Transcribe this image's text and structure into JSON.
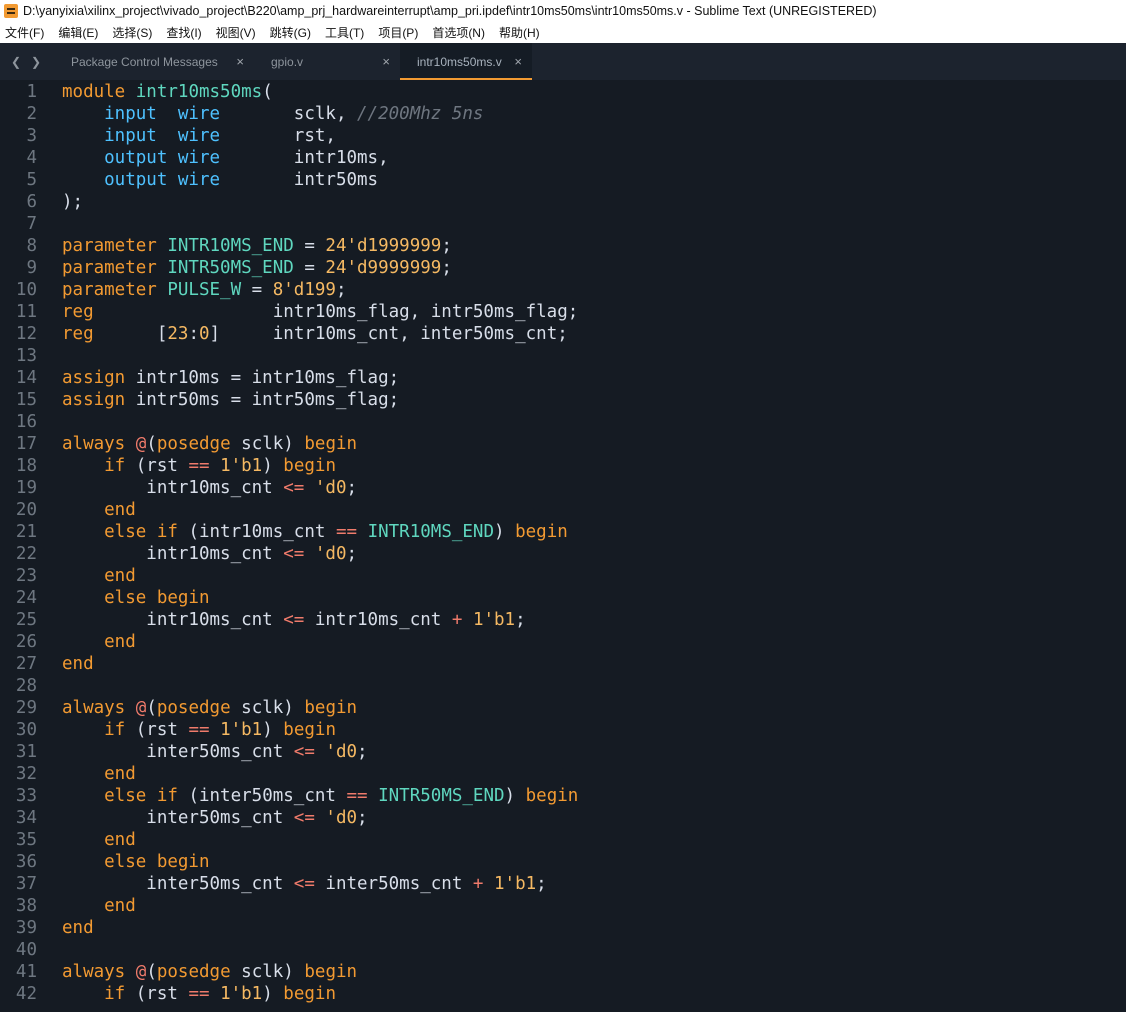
{
  "window": {
    "title": "D:\\yanyixia\\xilinx_project\\vivado_project\\B220\\amp_prj_hardwareinterrupt\\amp_pri.ipdef\\intr10ms50ms\\intr10ms50ms.v - Sublime Text (UNREGISTERED)",
    "app_icon": "sublime-text-icon"
  },
  "menu": [
    "文件(F)",
    "编辑(E)",
    "选择(S)",
    "查找(I)",
    "视图(V)",
    "跳转(G)",
    "工具(T)",
    "项目(P)",
    "首选项(N)",
    "帮助(H)"
  ],
  "tabs": [
    {
      "label": "Package Control Messages",
      "active": false
    },
    {
      "label": "gpio.v",
      "active": false
    },
    {
      "label": "intr10ms50ms.v",
      "active": true
    }
  ],
  "tab_close_glyph": "×",
  "nav": {
    "back": "❮",
    "forward": "❯"
  },
  "colors": {
    "keyword": "#f29a32",
    "type": "#4ec1ff",
    "name": "#5fd7bf",
    "comment": "#6e7680",
    "number": "#f5b963",
    "operator": "#f07b6b",
    "text": "#d8dee9",
    "editor_bg": "#151b23",
    "tabbar_bg": "#1c232e"
  },
  "code": [
    {
      "n": "1",
      "t": [
        [
          "module ",
          "kw"
        ],
        [
          "intr10ms50ms",
          "fn"
        ],
        [
          "(",
          "tx"
        ]
      ]
    },
    {
      "n": "2",
      "t": [
        [
          "    input  wire",
          "ty"
        ],
        [
          "       sclk, ",
          "tx"
        ],
        [
          "//200Mhz 5ns",
          "cm"
        ]
      ]
    },
    {
      "n": "3",
      "t": [
        [
          "    input  wire",
          "ty"
        ],
        [
          "       rst,",
          "tx"
        ]
      ]
    },
    {
      "n": "4",
      "t": [
        [
          "    output wire",
          "ty"
        ],
        [
          "       intr10ms,",
          "tx"
        ]
      ]
    },
    {
      "n": "5",
      "t": [
        [
          "    output wire",
          "ty"
        ],
        [
          "       intr50ms",
          "tx"
        ]
      ]
    },
    {
      "n": "6",
      "t": [
        [
          ");",
          "tx"
        ]
      ]
    },
    {
      "n": "7",
      "t": []
    },
    {
      "n": "8",
      "t": [
        [
          "parameter ",
          "kw"
        ],
        [
          "INTR10MS_END",
          "fn"
        ],
        [
          " = ",
          "tx"
        ],
        [
          "24'd1999999",
          "nm"
        ],
        [
          ";",
          "tx"
        ]
      ]
    },
    {
      "n": "9",
      "t": [
        [
          "parameter ",
          "kw"
        ],
        [
          "INTR50MS_END",
          "fn"
        ],
        [
          " = ",
          "tx"
        ],
        [
          "24'd9999999",
          "nm"
        ],
        [
          ";",
          "tx"
        ]
      ]
    },
    {
      "n": "10",
      "t": [
        [
          "parameter ",
          "kw"
        ],
        [
          "PULSE_W",
          "fn"
        ],
        [
          " = ",
          "tx"
        ],
        [
          "8'd199",
          "nm"
        ],
        [
          ";",
          "tx"
        ]
      ]
    },
    {
      "n": "11",
      "t": [
        [
          "reg",
          "kw"
        ],
        [
          "                 intr10ms_flag, intr50ms_flag;",
          "tx"
        ]
      ]
    },
    {
      "n": "12",
      "t": [
        [
          "reg",
          "kw"
        ],
        [
          "      [",
          "tx"
        ],
        [
          "23",
          "nm"
        ],
        [
          ":",
          "tx"
        ],
        [
          "0",
          "nm"
        ],
        [
          "]     intr10ms_cnt, inter50ms_cnt;",
          "tx"
        ]
      ]
    },
    {
      "n": "13",
      "t": []
    },
    {
      "n": "14",
      "t": [
        [
          "assign",
          "kw"
        ],
        [
          " intr10ms = intr10ms_flag;",
          "tx"
        ]
      ]
    },
    {
      "n": "15",
      "t": [
        [
          "assign",
          "kw"
        ],
        [
          " intr50ms = intr50ms_flag;",
          "tx"
        ]
      ]
    },
    {
      "n": "16",
      "t": []
    },
    {
      "n": "17",
      "t": [
        [
          "always",
          "kw"
        ],
        [
          " ",
          "tx"
        ],
        [
          "@",
          "op"
        ],
        [
          "(",
          "tx"
        ],
        [
          "posedge",
          "kw"
        ],
        [
          " sclk) ",
          "tx"
        ],
        [
          "begin",
          "kw"
        ]
      ]
    },
    {
      "n": "18",
      "t": [
        [
          "    if",
          "kw"
        ],
        [
          " (rst ",
          "tx"
        ],
        [
          "==",
          "op"
        ],
        [
          " ",
          "tx"
        ],
        [
          "1'b1",
          "nm"
        ],
        [
          ") ",
          "tx"
        ],
        [
          "begin",
          "kw"
        ]
      ]
    },
    {
      "n": "19",
      "t": [
        [
          "        intr10ms_cnt ",
          "tx"
        ],
        [
          "<=",
          "op"
        ],
        [
          " ",
          "tx"
        ],
        [
          "'d0",
          "nm"
        ],
        [
          ";",
          "tx"
        ]
      ]
    },
    {
      "n": "20",
      "t": [
        [
          "    end",
          "kw"
        ]
      ]
    },
    {
      "n": "21",
      "t": [
        [
          "    else if",
          "kw"
        ],
        [
          " (intr10ms_cnt ",
          "tx"
        ],
        [
          "==",
          "op"
        ],
        [
          " ",
          "tx"
        ],
        [
          "INTR10MS_END",
          "fn"
        ],
        [
          ") ",
          "tx"
        ],
        [
          "begin",
          "kw"
        ]
      ]
    },
    {
      "n": "22",
      "t": [
        [
          "        intr10ms_cnt ",
          "tx"
        ],
        [
          "<=",
          "op"
        ],
        [
          " ",
          "tx"
        ],
        [
          "'d0",
          "nm"
        ],
        [
          ";",
          "tx"
        ]
      ]
    },
    {
      "n": "23",
      "t": [
        [
          "    end",
          "kw"
        ]
      ]
    },
    {
      "n": "24",
      "t": [
        [
          "    else begin",
          "kw"
        ]
      ]
    },
    {
      "n": "25",
      "t": [
        [
          "        intr10ms_cnt ",
          "tx"
        ],
        [
          "<=",
          "op"
        ],
        [
          " intr10ms_cnt ",
          "tx"
        ],
        [
          "+",
          "op"
        ],
        [
          " ",
          "tx"
        ],
        [
          "1'b1",
          "nm"
        ],
        [
          ";",
          "tx"
        ]
      ]
    },
    {
      "n": "26",
      "t": [
        [
          "    end",
          "kw"
        ]
      ]
    },
    {
      "n": "27",
      "t": [
        [
          "end",
          "kw"
        ]
      ]
    },
    {
      "n": "28",
      "t": []
    },
    {
      "n": "29",
      "t": [
        [
          "always",
          "kw"
        ],
        [
          " ",
          "tx"
        ],
        [
          "@",
          "op"
        ],
        [
          "(",
          "tx"
        ],
        [
          "posedge",
          "kw"
        ],
        [
          " sclk) ",
          "tx"
        ],
        [
          "begin",
          "kw"
        ]
      ]
    },
    {
      "n": "30",
      "t": [
        [
          "    if",
          "kw"
        ],
        [
          " (rst ",
          "tx"
        ],
        [
          "==",
          "op"
        ],
        [
          " ",
          "tx"
        ],
        [
          "1'b1",
          "nm"
        ],
        [
          ") ",
          "tx"
        ],
        [
          "begin",
          "kw"
        ]
      ]
    },
    {
      "n": "31",
      "t": [
        [
          "        inter50ms_cnt ",
          "tx"
        ],
        [
          "<=",
          "op"
        ],
        [
          " ",
          "tx"
        ],
        [
          "'d0",
          "nm"
        ],
        [
          ";",
          "tx"
        ]
      ]
    },
    {
      "n": "32",
      "t": [
        [
          "    end",
          "kw"
        ]
      ]
    },
    {
      "n": "33",
      "t": [
        [
          "    else if",
          "kw"
        ],
        [
          " (inter50ms_cnt ",
          "tx"
        ],
        [
          "==",
          "op"
        ],
        [
          " ",
          "tx"
        ],
        [
          "INTR50MS_END",
          "fn"
        ],
        [
          ") ",
          "tx"
        ],
        [
          "begin",
          "kw"
        ]
      ]
    },
    {
      "n": "34",
      "t": [
        [
          "        inter50ms_cnt ",
          "tx"
        ],
        [
          "<=",
          "op"
        ],
        [
          " ",
          "tx"
        ],
        [
          "'d0",
          "nm"
        ],
        [
          ";",
          "tx"
        ]
      ]
    },
    {
      "n": "35",
      "t": [
        [
          "    end",
          "kw"
        ]
      ]
    },
    {
      "n": "36",
      "t": [
        [
          "    else begin",
          "kw"
        ]
      ]
    },
    {
      "n": "37",
      "t": [
        [
          "        inter50ms_cnt ",
          "tx"
        ],
        [
          "<=",
          "op"
        ],
        [
          " inter50ms_cnt ",
          "tx"
        ],
        [
          "+",
          "op"
        ],
        [
          " ",
          "tx"
        ],
        [
          "1'b1",
          "nm"
        ],
        [
          ";",
          "tx"
        ]
      ]
    },
    {
      "n": "38",
      "t": [
        [
          "    end",
          "kw"
        ]
      ]
    },
    {
      "n": "39",
      "t": [
        [
          "end",
          "kw"
        ]
      ]
    },
    {
      "n": "40",
      "t": []
    },
    {
      "n": "41",
      "t": [
        [
          "always",
          "kw"
        ],
        [
          " ",
          "tx"
        ],
        [
          "@",
          "op"
        ],
        [
          "(",
          "tx"
        ],
        [
          "posedge",
          "kw"
        ],
        [
          " sclk) ",
          "tx"
        ],
        [
          "begin",
          "kw"
        ]
      ]
    },
    {
      "n": "42",
      "t": [
        [
          "    if",
          "kw"
        ],
        [
          " (rst ",
          "tx"
        ],
        [
          "==",
          "op"
        ],
        [
          " ",
          "tx"
        ],
        [
          "1'b1",
          "nm"
        ],
        [
          ") ",
          "tx"
        ],
        [
          "begin",
          "kw"
        ]
      ]
    }
  ]
}
